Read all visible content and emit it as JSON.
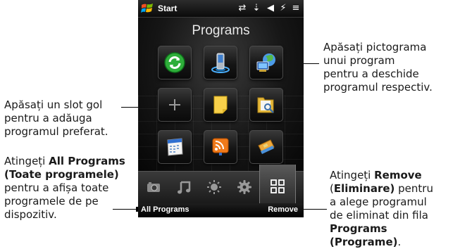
{
  "statusbar": {
    "start_label": "Start"
  },
  "screen": {
    "title": "Programs"
  },
  "softkeys": {
    "left": "All Programs",
    "right": "Remove"
  },
  "callouts": {
    "tap_icon": [
      "Apăsați pictograma",
      "unui program",
      "pentru a deschide",
      "programul respectiv."
    ],
    "empty_slot": [
      "Apăsați un slot gol",
      "pentru a adăuga",
      "programul preferat."
    ],
    "all_programs_prefix": "Atingeți ",
    "all_programs_bold1": "All Programs",
    "all_programs_bold2": "(Toate programele)",
    "all_programs_rest": [
      "pentru a afișa toate",
      "programele de pe",
      "dispozitiv."
    ],
    "remove_prefix": "Atingeți ",
    "remove_bold": "Remove",
    "remove_open": "(",
    "remove_bold2": "Eliminare)",
    "remove_rest1": " pentru",
    "remove_rest": [
      "a alege programul",
      "de eliminat din fila"
    ],
    "remove_bold3": "Programs (Programe)",
    "remove_end": "."
  },
  "tiles": [
    {
      "name": "sync-icon"
    },
    {
      "name": "phone-icon"
    },
    {
      "name": "globe-icon"
    },
    {
      "name": "add-slot-icon"
    },
    {
      "name": "notes-icon"
    },
    {
      "name": "file-search-icon"
    },
    {
      "name": "calendar-icon"
    },
    {
      "name": "rss-icon"
    },
    {
      "name": "sim-card-icon"
    }
  ],
  "tabs": [
    {
      "name": "tab-photos"
    },
    {
      "name": "tab-music"
    },
    {
      "name": "tab-weather"
    },
    {
      "name": "tab-settings"
    },
    {
      "name": "tab-programs"
    }
  ]
}
